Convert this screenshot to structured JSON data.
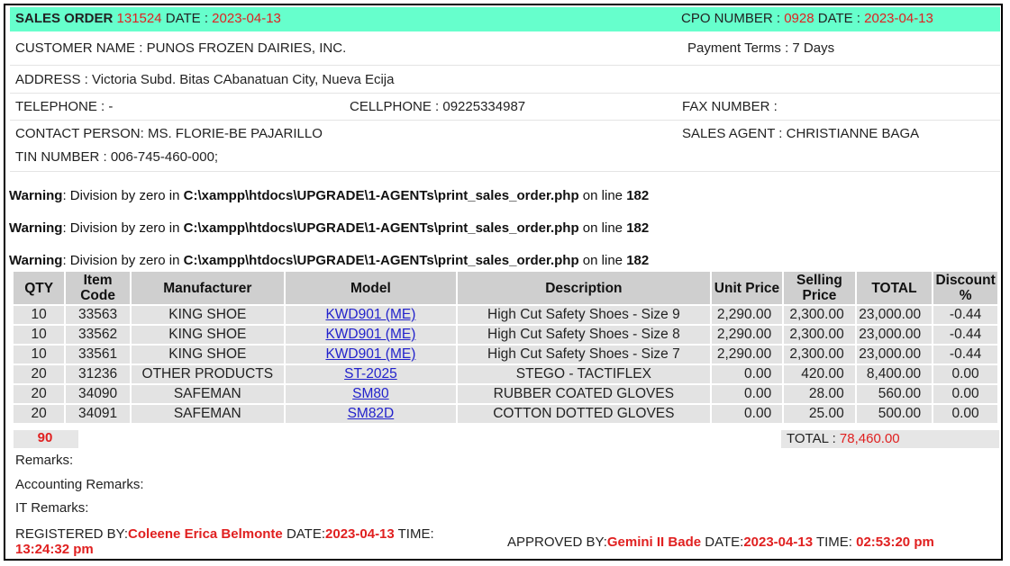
{
  "header": {
    "so_label": "SALES ORDER",
    "so_number": "131524",
    "date_label": "DATE :",
    "so_date": "2023-04-13",
    "cpo_label": "CPO NUMBER :",
    "cpo_number": "0928",
    "cpo_date_label": "DATE :",
    "cpo_date": "2023-04-13"
  },
  "customer": {
    "name": "CUSTOMER NAME : PUNOS FROZEN DAIRIES, INC.",
    "payment_terms": "Payment Terms : 7 Days",
    "address": "ADDRESS : Victoria Subd. Bitas CAbanatuan City, Nueva Ecija",
    "telephone": "TELEPHONE : -",
    "cellphone": "CELLPHONE : 09225334987",
    "fax": "FAX NUMBER :",
    "contact": "CONTACT PERSON: MS. FLORIE-BE PAJARILLO",
    "sales_agent": "SALES AGENT : CHRISTIANNE BAGA",
    "tin": "TIN NUMBER : 006-745-460-000;"
  },
  "warnings": [
    {
      "label": "Warning",
      "text": ": Division by zero in ",
      "path": "C:\\xampp\\htdocs\\UPGRADE\\1-AGENTs\\print_sales_order.php",
      "online": " on line ",
      "line": "182"
    },
    {
      "label": "Warning",
      "text": ": Division by zero in ",
      "path": "C:\\xampp\\htdocs\\UPGRADE\\1-AGENTs\\print_sales_order.php",
      "online": " on line ",
      "line": "182"
    },
    {
      "label": "Warning",
      "text": ": Division by zero in ",
      "path": "C:\\xampp\\htdocs\\UPGRADE\\1-AGENTs\\print_sales_order.php",
      "online": " on line ",
      "line": "182"
    }
  ],
  "table": {
    "headers": [
      "QTY",
      "Item Code",
      "Manufacturer",
      "Model",
      "Description",
      "Unit Price",
      "Selling Price",
      "TOTAL",
      "Discount %"
    ],
    "rows": [
      {
        "qty": "10",
        "code": "33563",
        "mfr": "KING SHOE",
        "model": "KWD901 (ME)",
        "desc": "High Cut Safety Shoes - Size 9",
        "unit": "2,290.00",
        "selling": "2,300.00",
        "total": "23,000.00",
        "disc": "-0.44"
      },
      {
        "qty": "10",
        "code": "33562",
        "mfr": "KING SHOE",
        "model": "KWD901 (ME)",
        "desc": "High Cut Safety Shoes - Size 8",
        "unit": "2,290.00",
        "selling": "2,300.00",
        "total": "23,000.00",
        "disc": "-0.44"
      },
      {
        "qty": "10",
        "code": "33561",
        "mfr": "KING SHOE",
        "model": "KWD901 (ME)",
        "desc": "High Cut Safety Shoes - Size 7",
        "unit": "2,290.00",
        "selling": "2,300.00",
        "total": "23,000.00",
        "disc": "-0.44"
      },
      {
        "qty": "20",
        "code": "31236",
        "mfr": "OTHER PRODUCTS",
        "model": "ST-2025",
        "desc": "STEGO - TACTIFLEX",
        "unit": "0.00",
        "selling": "420.00",
        "total": "8,400.00",
        "disc": "0.00"
      },
      {
        "qty": "20",
        "code": "34090",
        "mfr": "SAFEMAN",
        "model": "SM80",
        "desc": "RUBBER COATED GLOVES",
        "unit": "0.00",
        "selling": "28.00",
        "total": "560.00",
        "disc": "0.00"
      },
      {
        "qty": "20",
        "code": "34091",
        "mfr": "SAFEMAN",
        "model": "SM82D",
        "desc": "COTTON DOTTED GLOVES",
        "unit": "0.00",
        "selling": "25.00",
        "total": "500.00",
        "disc": "0.00"
      }
    ],
    "qty_total": "90",
    "total_label": "TOTAL :",
    "grand_total": "78,460.00"
  },
  "remarks": {
    "remarks": "Remarks:",
    "accounting": "Accounting Remarks:",
    "it": "IT Remarks:"
  },
  "footer": {
    "registered_label": "REGISTERED BY:",
    "registered_by": "Coleene Erica Belmonte",
    "reg_date_label": " DATE:",
    "reg_date": "2023-04-13",
    "reg_time_label": " TIME:",
    "reg_time": "13:24:32 pm",
    "approved_label": "APPROVED BY:",
    "approved_by": "Gemini II Bade",
    "app_date_label": " DATE:",
    "app_date": "2023-04-13",
    "app_time_label": " TIME: ",
    "app_time": "02:53:20 pm"
  }
}
